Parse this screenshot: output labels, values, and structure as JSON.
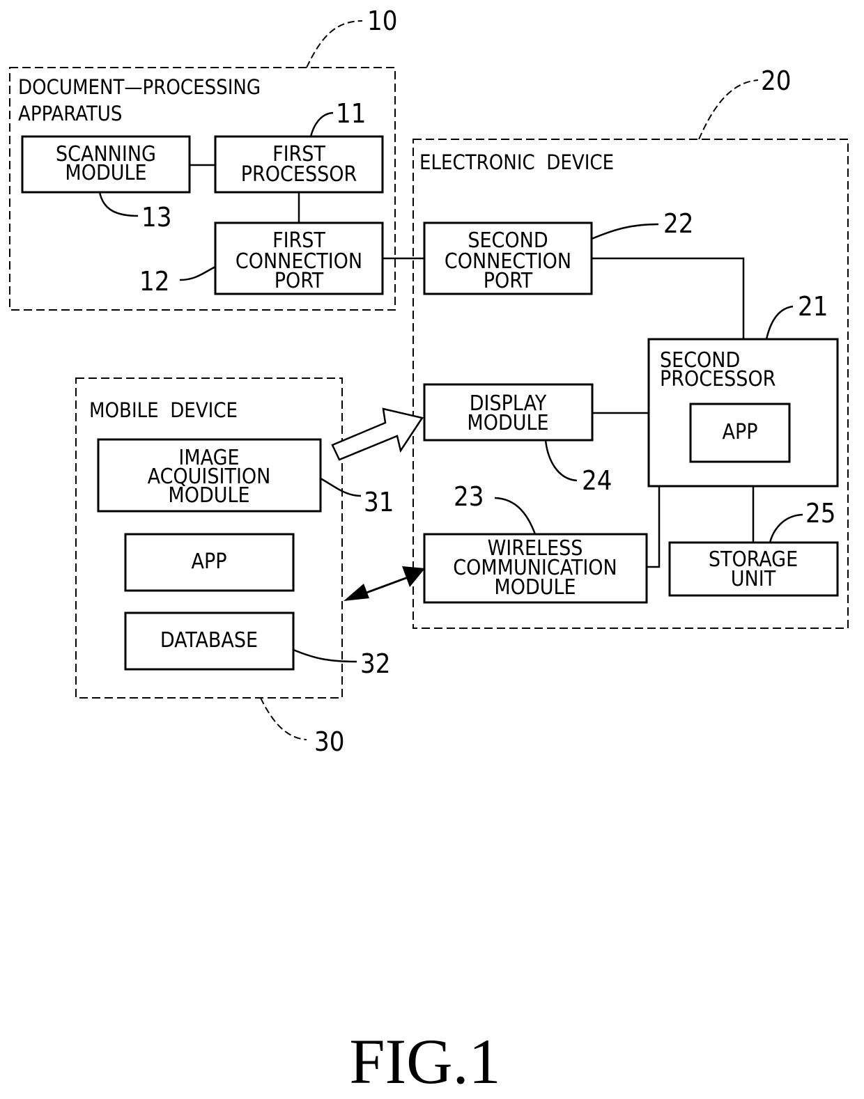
{
  "figure_caption": "FIG.1",
  "groups": {
    "document_processing_apparatus": {
      "ref": "10",
      "title_line1": "DOCUMENT—PROCESSING",
      "title_line2": "APPARATUS",
      "blocks": {
        "scanning_module": {
          "ref": "13",
          "lines": [
            "SCANNING",
            "MODULE"
          ]
        },
        "first_processor": {
          "ref": "11",
          "lines": [
            "FIRST",
            "PROCESSOR"
          ]
        },
        "first_connection_port": {
          "ref": "12",
          "lines": [
            "FIRST",
            "CONNECTION",
            "PORT"
          ]
        }
      }
    },
    "electronic_device": {
      "ref": "20",
      "title": "ELECTRONIC  DEVICE",
      "blocks": {
        "second_connection_port": {
          "ref": "22",
          "lines": [
            "SECOND",
            "CONNECTION",
            "PORT"
          ]
        },
        "second_processor": {
          "ref": "21",
          "lines": [
            "SECOND",
            "PROCESSOR"
          ],
          "inner": "APP"
        },
        "display_module": {
          "ref": "24",
          "lines": [
            "DISPLAY",
            "MODULE"
          ]
        },
        "wireless_communication_module": {
          "ref": "23",
          "lines": [
            "WIRELESS",
            "COMMUNICATION",
            "MODULE"
          ]
        },
        "storage_unit": {
          "ref": "25",
          "lines": [
            "STORAGE",
            "UNIT"
          ]
        }
      }
    },
    "mobile_device": {
      "ref": "30",
      "title": "MOBILE  DEVICE",
      "blocks": {
        "image_acquisition_module": {
          "ref": "31",
          "lines": [
            "IMAGE",
            "ACQUISITION",
            "MODULE"
          ]
        },
        "app": {
          "lines": [
            "APP"
          ]
        },
        "database": {
          "ref": "32",
          "lines": [
            "DATABASE"
          ]
        }
      }
    }
  }
}
